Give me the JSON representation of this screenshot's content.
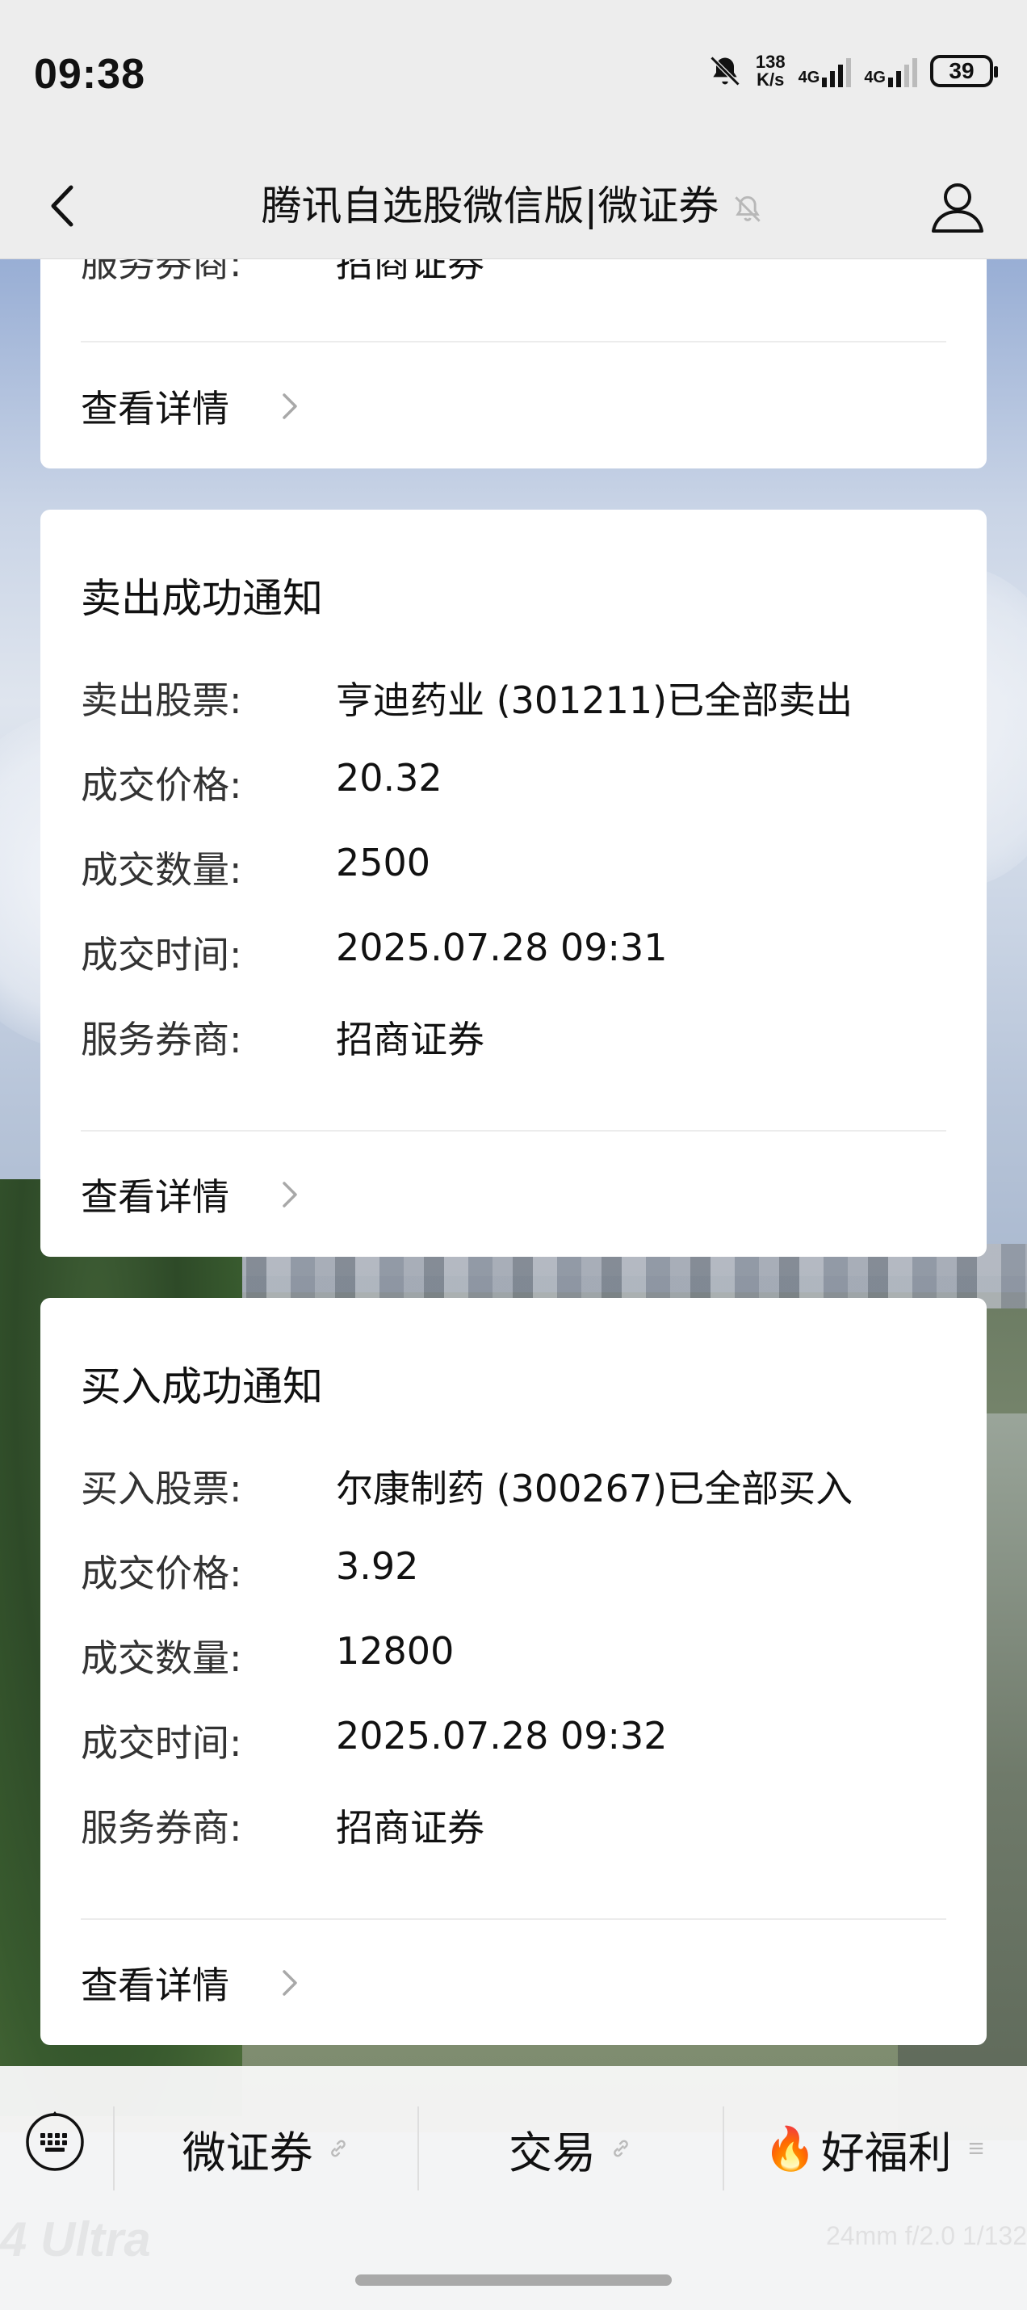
{
  "status_bar": {
    "time": "09:38",
    "speed_top": "138",
    "speed_bottom": "K/s",
    "sim1": "4G",
    "sim2": "4G",
    "battery": "39"
  },
  "nav": {
    "title": "腾讯自选股微信版|微证券"
  },
  "cards": [
    {
      "partial_row_label": "服务券商:",
      "partial_row_value": "招商证券",
      "detail": "查看详情"
    },
    {
      "title": "卖出成功通知",
      "rows": [
        {
          "label": "卖出股票:",
          "value": "亨迪药业 (301211)已全部卖出"
        },
        {
          "label": "成交价格:",
          "value": "20.32"
        },
        {
          "label": "成交数量:",
          "value": "2500"
        },
        {
          "label": "成交时间:",
          "value": "2025.07.28 09:31"
        },
        {
          "label": "服务券商:",
          "value": "招商证券"
        }
      ],
      "detail": "查看详情"
    },
    {
      "title": "买入成功通知",
      "rows": [
        {
          "label": "买入股票:",
          "value": "尔康制药 (300267)已全部买入"
        },
        {
          "label": "成交价格:",
          "value": "3.92"
        },
        {
          "label": "成交数量:",
          "value": "12800"
        },
        {
          "label": "成交时间:",
          "value": "2025.07.28 09:32"
        },
        {
          "label": "服务券商:",
          "value": "招商证券"
        }
      ],
      "detail": "查看详情"
    }
  ],
  "bottom_menu": [
    {
      "label": "微证券",
      "icon": "link-icon"
    },
    {
      "label": "交易",
      "icon": "link-icon"
    },
    {
      "label": "好福利",
      "icon": "menu-icon",
      "prefix": "🔥"
    }
  ],
  "watermark": {
    "left": "4 Ultra",
    "right": "24mm  f/2.0  1/132"
  }
}
